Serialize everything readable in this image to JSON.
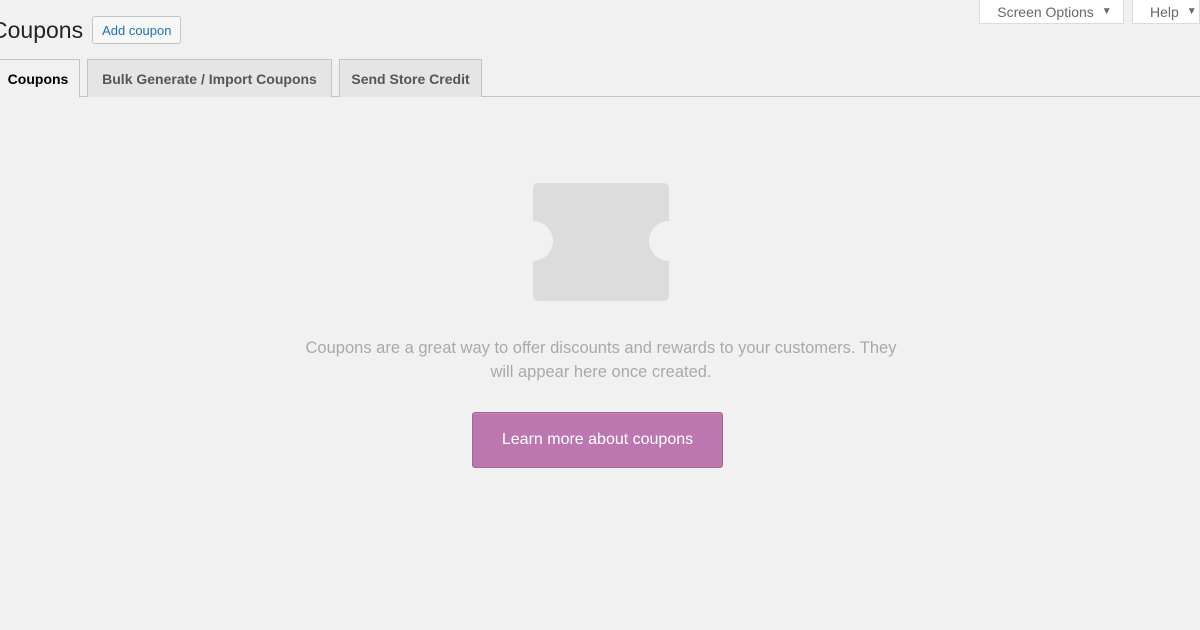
{
  "screen_meta": {
    "screen_options_label": "Screen Options",
    "help_label": "Help"
  },
  "header": {
    "title": "Coupons",
    "add_button_label": "Add coupon"
  },
  "tabs": [
    {
      "label": "Coupons",
      "active": true
    },
    {
      "label": "Bulk Generate / Import Coupons",
      "active": false
    },
    {
      "label": "Send Store Credit",
      "active": false
    }
  ],
  "empty_state": {
    "icon": "coupon-ticket-icon",
    "message": "Coupons are a great way to offer discounts and rewards to your customers. They will appear here once created.",
    "cta_label": "Learn more about coupons"
  },
  "colors": {
    "background": "#f1f1f1",
    "accent": "#bb77ae",
    "link": "#2271b1",
    "muted_text": "#a7aaad",
    "icon_fill": "#dcdcdc"
  }
}
